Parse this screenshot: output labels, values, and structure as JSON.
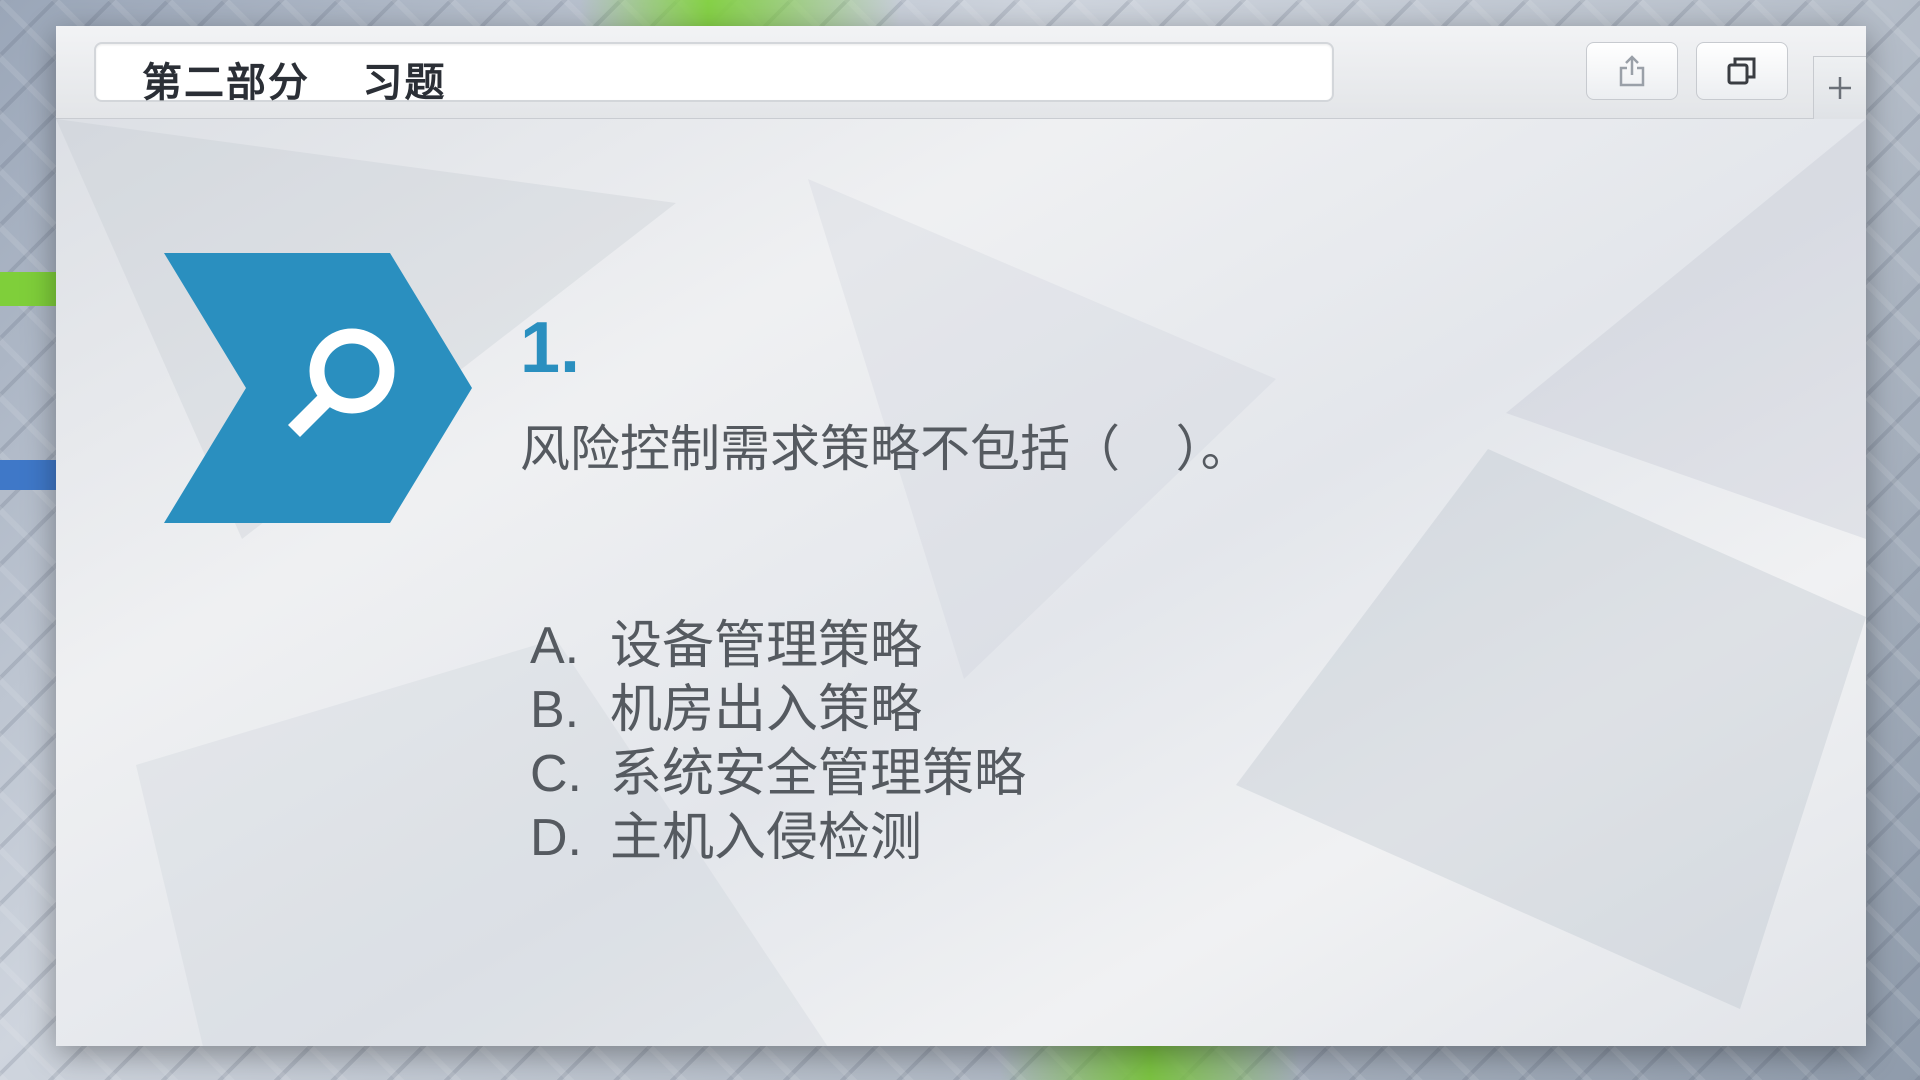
{
  "window": {
    "address_text": "第二部分    习题"
  },
  "toolbar": {
    "share_icon": "share-icon",
    "tabs_icon": "tabs-icon",
    "new_tab_icon": "plus-icon"
  },
  "slide": {
    "icon": "magnifier-icon",
    "accent_color": "#2a8fbf",
    "question_number": "1.",
    "question_text": "风险控制需求策略不包括（    ）。",
    "options": [
      {
        "letter": "A.",
        "text": "设备管理策略"
      },
      {
        "letter": "B.",
        "text": "机房出入策略"
      },
      {
        "letter": "C.",
        "text": "系统安全管理策略"
      },
      {
        "letter": "D.",
        "text": "主机入侵检测"
      }
    ]
  }
}
